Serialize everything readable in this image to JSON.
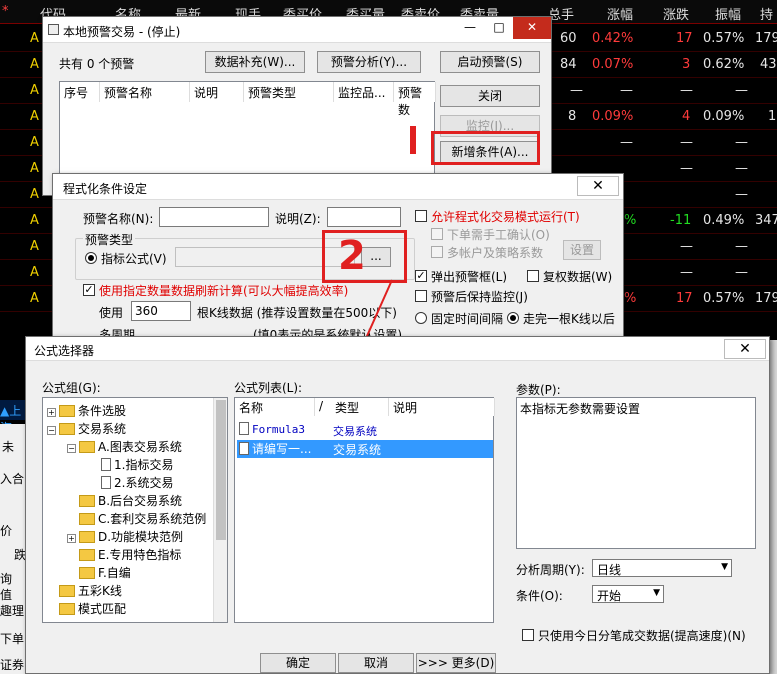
{
  "bg_table": {
    "headers": [
      "代码",
      "名称",
      "最新",
      "现手",
      "委买价",
      "委买量",
      "委卖价",
      "委卖量",
      "总手",
      "涨幅",
      "涨跌",
      "振幅",
      "持"
    ],
    "row_prefix": "A",
    "rows": [
      {
        "zongshou": "60",
        "zhangfu": "0.42%",
        "zhangdie": "17",
        "zhenfu": "0.57%",
        "chi": "179"
      },
      {
        "zongshou": "84",
        "zhangfu": "0.07%",
        "zhangdie": "3",
        "zhenfu": "0.62%",
        "chi": "43"
      },
      {
        "zongshou": "8",
        "zhangfu": "0.09%",
        "zhangdie": "4",
        "zhenfu": "0.09%",
        "chi": "1"
      },
      {
        "zongshou": "",
        "zhangfu": "%",
        "zhangdie": "-11",
        "zhenfu": "0.49%",
        "chi": "347"
      },
      {
        "zongshou": "",
        "zhangfu": "%",
        "zhangdie": "17",
        "zhenfu": "0.57%",
        "chi": "179"
      }
    ],
    "dash": "—",
    "left_labels": [
      "上海",
      "未",
      "入合",
      "价",
      "跌",
      "询",
      "值",
      "趣理",
      "下单",
      "证券"
    ]
  },
  "warn_window": {
    "title": "本地预警交易 - (停止)",
    "count_text": "共有 0 个预警",
    "data_fill_btn": "数据补充(W)...",
    "analysis_btn": "预警分析(Y)...",
    "start_btn": "启动预警(S)",
    "close_btn": "关闭",
    "monitor_btn": "监控(J)...",
    "add_cond_btn": "新增条件(A)...",
    "columns": [
      "序号",
      "预警名称",
      "说明",
      "预警类型",
      "监控品...",
      "预警数"
    ]
  },
  "cond_dialog": {
    "title": "程式化条件设定",
    "name_label": "预警名称(N):",
    "desc_label": "说明(Z):",
    "type_group": "预警类型",
    "indicator_label": "指标公式(V)",
    "browse_btn": "...",
    "allow_trade": "允许程式化交易模式运行(T)",
    "manual_confirm": "下单需手工确认(O)",
    "multi_account": "多帐户及策略系数",
    "settings_btn": "设置",
    "popup": "弹出预警框(L)",
    "reuse_data": "复权数据(W)",
    "keep_monitor": "预警后保持监控(J)",
    "fixed_interval": "固定时间间隔",
    "after_kline": "走完一根K线以后",
    "use_count_text": "使用指定数量数据刷新计算(可以大幅提高效率)",
    "use_label": "使用",
    "use_value": "360",
    "kline_text": "根K线数据 (推荐设置数量在500以下)",
    "multi_period": "多周期",
    "period_note": "(填0表示的是系统默认设置)"
  },
  "formula_dialog": {
    "title": "公式选择器",
    "group_label": "公式组(G):",
    "list_label": "公式列表(L):",
    "param_label": "参数(P):",
    "param_text": "本指标无参数需要设置",
    "tree": [
      {
        "label": "条件选股",
        "lvl": 0,
        "pm": "+",
        "icon": "folder"
      },
      {
        "label": "交易系统",
        "lvl": 0,
        "pm": "-",
        "icon": "folder"
      },
      {
        "label": "A.图表交易系统",
        "lvl": 1,
        "pm": "-",
        "icon": "folder"
      },
      {
        "label": "1.指标交易",
        "lvl": 2,
        "pm": "",
        "icon": "page"
      },
      {
        "label": "2.系统交易",
        "lvl": 2,
        "pm": "",
        "icon": "page"
      },
      {
        "label": "B.后台交易系统",
        "lvl": 1,
        "pm": "",
        "icon": "folder"
      },
      {
        "label": "C.套利交易系统范例",
        "lvl": 1,
        "pm": "",
        "icon": "folder"
      },
      {
        "label": "D.功能模块范例",
        "lvl": 1,
        "pm": "+",
        "icon": "folder"
      },
      {
        "label": "E.专用特色指标",
        "lvl": 1,
        "pm": "",
        "icon": "folder"
      },
      {
        "label": "F.自编",
        "lvl": 1,
        "pm": "",
        "icon": "folder"
      },
      {
        "label": "五彩K线",
        "lvl": 0,
        "pm": "",
        "icon": "folder"
      },
      {
        "label": "模式匹配",
        "lvl": 0,
        "pm": "",
        "icon": "folder"
      }
    ],
    "list_cols": [
      "名称",
      "/",
      "类型",
      "说明"
    ],
    "list_rows": [
      {
        "name": "Formula3",
        "type": "交易系统"
      },
      {
        "name": "请编写一...",
        "type": "交易系统"
      }
    ],
    "period_label": "分析周期(Y):",
    "period_value": "日线",
    "cond_label": "条件(O):",
    "cond_value": "开始",
    "tick_only": "只使用今日分笔成交数据(提高速度)(N)",
    "ok_btn": "确定",
    "cancel_btn": "取消",
    "more_btn": ">>> 更多(D)"
  },
  "annotations": {
    "step1": "1",
    "step2": "2"
  }
}
